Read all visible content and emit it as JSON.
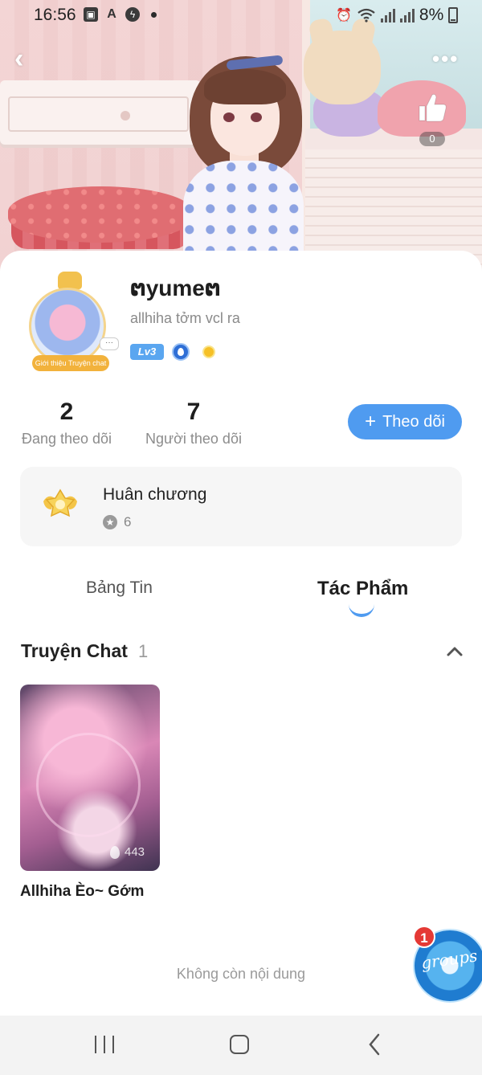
{
  "status_bar": {
    "time": "16:56",
    "battery": "8%",
    "app_icons": [
      "gallery-icon",
      "a-app-icon",
      "messenger-icon"
    ]
  },
  "header": {
    "like_count": "0"
  },
  "profile": {
    "username": "ຕyumeຕ",
    "bio": "allhiha tởm vcl ra",
    "level_badge": "Lv3",
    "avatar_ribbon": "Giới thiệu Truyện chat",
    "avatar_bubble": "···"
  },
  "stats": {
    "following_count": "2",
    "following_label": "Đang theo dõi",
    "followers_count": "7",
    "followers_label": "Người theo dõi"
  },
  "follow_button": {
    "label": "Theo dõi"
  },
  "medal": {
    "title": "Huân chương",
    "count": "6"
  },
  "tabs": [
    {
      "label": "Bảng Tin",
      "active": false
    },
    {
      "label": "Tác Phẩm",
      "active": true
    }
  ],
  "section": {
    "title": "Truyện Chat",
    "count": "1"
  },
  "stories": [
    {
      "title": "Allhiha Èo~ Gớm",
      "views": "443"
    }
  ],
  "footer": {
    "no_more": "Không còn nội dung"
  },
  "floating": {
    "notification_count": "1",
    "text": "groups"
  },
  "colors": {
    "accent": "#4f9bf0",
    "notification": "#e53935"
  }
}
